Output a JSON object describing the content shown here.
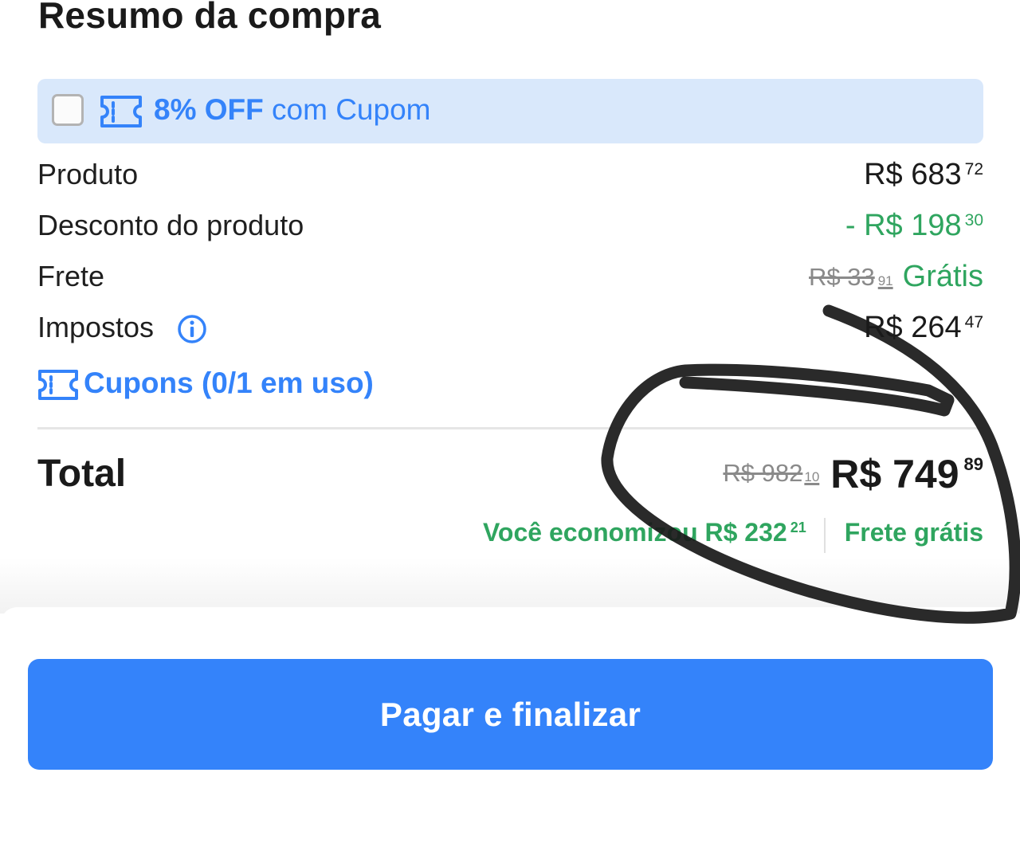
{
  "header": {
    "title": "Resumo da compra"
  },
  "coupon_banner": {
    "discount": "8% OFF",
    "suffix": "com Cupom",
    "checked": false
  },
  "summary": {
    "produto": {
      "label": "Produto",
      "value": "R$ 683",
      "cents": "72"
    },
    "desconto": {
      "label": "Desconto do produto",
      "value": "- R$ 198",
      "cents": "30"
    },
    "frete": {
      "label": "Frete",
      "old_value": "R$ 33",
      "old_cents": "91",
      "value": "Grátis"
    },
    "impostos": {
      "label": "Impostos",
      "value": "R$ 264",
      "cents": "47"
    }
  },
  "cupons_link": {
    "label": "Cupons (0/1 em uso)"
  },
  "total": {
    "label": "Total",
    "old_value": "R$ 982",
    "old_cents": "10",
    "value": "R$ 749",
    "cents": "89",
    "savings_text": "Você economizou R$ 232",
    "savings_cents": "21",
    "free_shipping": "Frete grátis"
  },
  "actions": {
    "pay_label": "Pagar e finalizar"
  },
  "colors": {
    "accent_blue": "#3483fa",
    "banner_bg": "#d9e8fb",
    "success_green": "#2fa55f",
    "annotation_black": "#1a1a1a"
  }
}
